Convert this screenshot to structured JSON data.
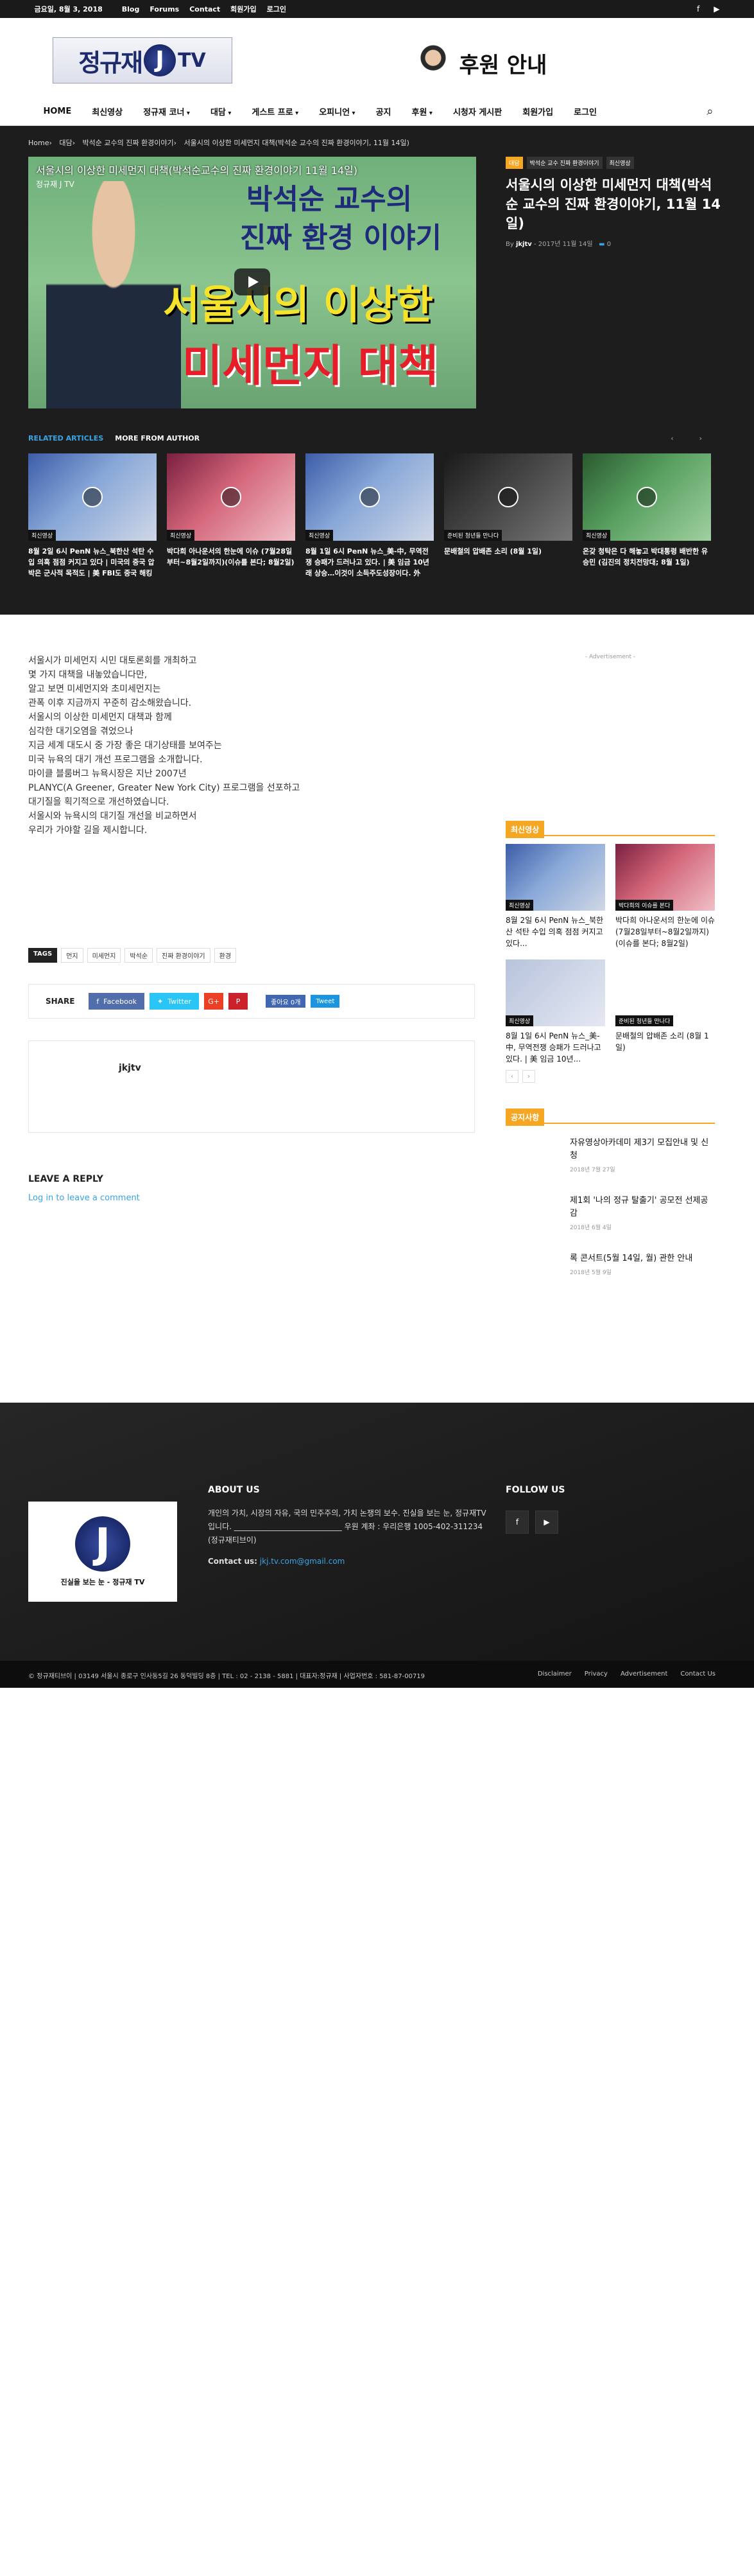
{
  "topbar": {
    "date": "금요일, 8월 3, 2018",
    "links": [
      "Blog",
      "Forums",
      "Contact",
      "회원가입",
      "로그인"
    ],
    "social": [
      "f",
      "▶"
    ]
  },
  "header": {
    "logo_kr": "정규재",
    "logo_j": "J",
    "logo_tv": "TV",
    "sponsor_text": "후원 안내"
  },
  "nav": {
    "items": [
      "HOME",
      "최신영상",
      "정규재 코너",
      "대담",
      "게스트 프로",
      "오피니언",
      "공지",
      "후원",
      "시청자 게시판",
      "회원가입",
      "로그인"
    ],
    "search_icon": "⌕"
  },
  "breadcrumb": [
    "Home",
    "›",
    "대담",
    "›",
    "박석순 교수의 진짜 환경이야기",
    "›",
    "서울시의 이상한 미세먼지 대책(박석순 교수의 진짜 환경이야기, 11월 14일)"
  ],
  "video": {
    "title": "서울시의 이상한 미세먼지 대책(박석순교수의 진짜 환경이야기 11월 14일)",
    "channel": "정규재 J TV",
    "line1": "박석순 교수의",
    "line2": "진짜 환경 이야기",
    "line3": "서울시의 이상한",
    "line4": "미세먼지 대책"
  },
  "post": {
    "cats": [
      "대담",
      "박석순 교수 진짜 환경이야기",
      "최신영상"
    ],
    "title": "서울시의 이상한 미세먼지 대책(박석순 교수의 진짜 환경이야기, 11월 14일)",
    "by": "By",
    "author": "jkjtv",
    "date": "2017년 11월 14일",
    "comments": "0"
  },
  "related": {
    "tab1": "RELATED ARTICLES",
    "tab2": "MORE FROM AUTHOR",
    "pager": "‹ ›",
    "items": [
      {
        "cat": "최신영상",
        "title": "8월 2일 6시 PenN 뉴스_북한산 석탄 수입 의혹 점점 커지고 있다 | 미국의 중국 압박은 군사적 목적도 | 美 FBI도 중국 해킹기 원장까"
      },
      {
        "cat": "최신영상",
        "title": "박다희 아나운서의 한눈에 이슈 (7월28일부터~8월2일까지)(이슈를 본다; 8월2일)"
      },
      {
        "cat": "최신영상",
        "title": "8월 1일 6시 PenN 뉴스_美-中, 무역전쟁 승패가 드러나고 있다. | 美 임금 10년래 상승…이것이 소득주도성장이다. 外"
      },
      {
        "cat": "준비된 청년들 만나다",
        "title": "문배철의 압배존 소리 (8월 1일)"
      },
      {
        "cat": "최신영상",
        "title": "온갖 청탁은 다 해놓고 박대통령 배반한 유승민 (김진의 정치전망대; 8월 1일)"
      }
    ]
  },
  "content": [
    "서울시가 미세먼지 시민 대토론회를 개최하고",
    "몇 가지 대책을 내놓았습니다만,",
    "알고 보면 미세먼지와 초미세먼지는",
    "관폭 이후 지금까지 꾸준히 감소해왔습니다.",
    "서울시의 이상한 미세먼지 대책과 함께",
    "심각한 대기오염을 겪었으나",
    "지금 세계 대도시 중 가장 좋은 대기상태를 보여주는",
    "미국 뉴욕의 대기 개선 프로그램을 소개합니다.",
    "마이클 블룸버그 뉴욕시장은 지난 2007년",
    "PLANYC(A Greener, Greater New York City) 프로그램을 선포하고",
    "대기질을 획기적으로 개선하였습니다.",
    "서울시와 뉴욕시의 대기질 개선을 비교하면서",
    "우리가 가야할 길을 제시합니다."
  ],
  "tags": {
    "label": "TAGS",
    "items": [
      "먼지",
      "미세먼지",
      "박석순",
      "진짜 환경이야기",
      "환경"
    ]
  },
  "share": {
    "label": "SHARE",
    "facebook": "Facebook",
    "twitter": "Twitter",
    "gplus": "G+",
    "pinterest": "P",
    "like": "좋아요 0개",
    "tweet": "Tweet"
  },
  "author_box": {
    "name": "jkjtv"
  },
  "reply": {
    "heading": "LEAVE A REPLY",
    "login": "Log in to leave a comment"
  },
  "sidebar": {
    "ad": "- Advertisement -",
    "latest_title": "최신영상",
    "latest": [
      {
        "cat": "최신영상",
        "title": "8월 2일 6시 PenN 뉴스_북한산 석탄 수입 의혹 점점 커지고 있다..."
      },
      {
        "cat": "박다희의 이슈를 본다",
        "title": "박다희 아나운서의 한눈에 이슈 (7월28일부터~8월2일까지)(이슈를 본다; 8월2일)"
      },
      {
        "cat": "최신영상",
        "title": "8월 1일 6시 PenN 뉴스_美-中, 무역전쟁 승패가 드러나고 있다. | 美 임금 10년..."
      },
      {
        "cat": "준비된 청년들 만나다",
        "title": "문배철의 압배존 소리 (8월 1일)"
      }
    ],
    "pager": [
      "‹",
      "›"
    ],
    "notice_title": "공지사항",
    "notices": [
      {
        "title": "자유영상아카데미 제3기 모집안내 및 신청",
        "date": "2018년 7월 27일"
      },
      {
        "title": "제1회 '나의 정규 탈출기' 공모전 선제공감",
        "date": "2018년 6월 4일"
      },
      {
        "title": "록 콘서트(5월 14일, 월) 관한 안내",
        "date": "2018년 5월 9일"
      }
    ]
  },
  "footer": {
    "logo_j": "J",
    "logo_tagline": "진실을 보는 눈 - 정규재 TV",
    "about_title": "ABOUT US",
    "about_text": "개인의 가치, 시장의 자유, 국의 민주주의, 가치 논쟁의 보수. 진실을 보는 눈, 정규재TV입니다. ____________________________ 우원 계좌 : 우리은행 1005-402-311234 (정규재티브이)",
    "contact_label": "Contact us:",
    "contact_email": "jkj.tv.com@gmail.com",
    "follow_title": "FOLLOW US",
    "follow_icons": [
      "f",
      "▶"
    ]
  },
  "subfooter": {
    "copyright": "© 정규재티브이 | 03149 서울시 종로구 인사동5길 26 동덕빌딩 8층 | TEL : 02 - 2138 - 5881 | 대표자:정규재 | 사업자번호 : 581-87-00719",
    "links": [
      "Disclaimer",
      "Privacy",
      "Advertisement",
      "Contact Us"
    ]
  }
}
